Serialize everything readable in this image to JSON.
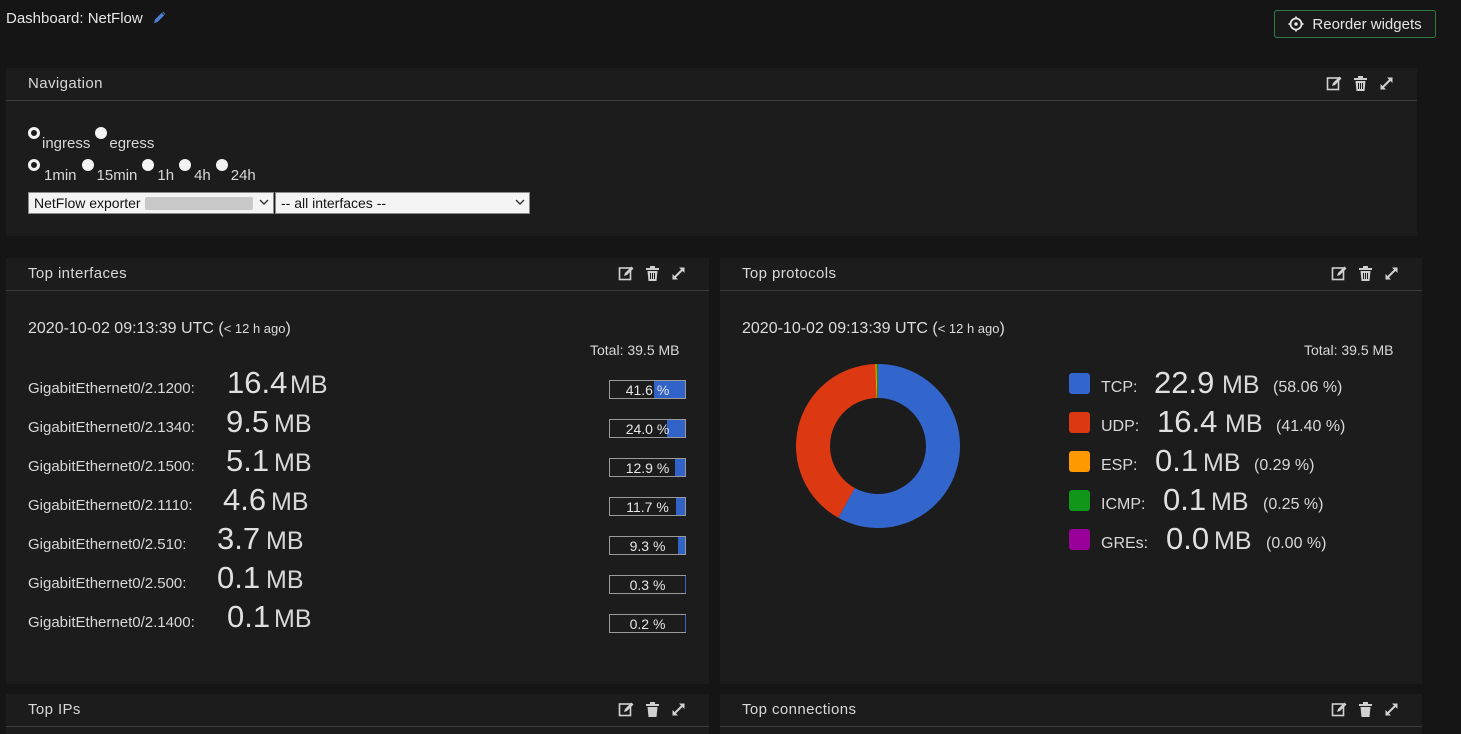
{
  "dashboard": {
    "title": "Dashboard: NetFlow",
    "reorder_label": "Reorder widgets"
  },
  "navigation": {
    "title": "Navigation",
    "direction_options": [
      {
        "label": "ingress",
        "checked": true
      },
      {
        "label": "egress",
        "checked": false
      }
    ],
    "time_options": [
      {
        "label": "1min",
        "checked": true
      },
      {
        "label": "15min",
        "checked": false
      },
      {
        "label": "1h",
        "checked": false
      },
      {
        "label": "4h",
        "checked": false
      },
      {
        "label": "24h",
        "checked": false
      }
    ],
    "exporter_select": "NetFlow exporter",
    "interface_select": "-- all interfaces --"
  },
  "top_interfaces": {
    "title": "Top interfaces",
    "timestamp": "2020-10-02 09:13:39 UTC",
    "timestamp_open": " (",
    "timestamp_ago": "< 12 h ago",
    "timestamp_close": ")",
    "total": "Total: 39.5 MB",
    "rows": [
      {
        "name": "GigabitEthernet0/2.1200:",
        "value": "16.4",
        "unit": "MB",
        "percent": "41.6 %",
        "fraction": 0.416
      },
      {
        "name": "GigabitEthernet0/2.1340:",
        "value": "9.5",
        "unit": "MB",
        "percent": "24.0 %",
        "fraction": 0.24
      },
      {
        "name": "GigabitEthernet0/2.1500:",
        "value": "5.1",
        "unit": "MB",
        "percent": "12.9 %",
        "fraction": 0.129
      },
      {
        "name": "GigabitEthernet0/2.1110:",
        "value": "4.6",
        "unit": "MB",
        "percent": "11.7 %",
        "fraction": 0.117
      },
      {
        "name": "GigabitEthernet0/2.510:",
        "value": "3.7",
        "unit": "MB",
        "percent": "9.3 %",
        "fraction": 0.093
      },
      {
        "name": "GigabitEthernet0/2.500:",
        "value": "0.1",
        "unit": "MB",
        "percent": "0.3 %",
        "fraction": 0.003
      },
      {
        "name": "GigabitEthernet0/2.1400:",
        "value": "0.1",
        "unit": "MB",
        "percent": "0.2 %",
        "fraction": 0.002
      }
    ]
  },
  "top_protocols": {
    "title": "Top protocols",
    "timestamp": "2020-10-02 09:13:39 UTC",
    "timestamp_open": " (",
    "timestamp_ago": "< 12 h ago",
    "timestamp_close": ")",
    "total": "Total: 39.5 MB",
    "legend": [
      {
        "name": "TCP:",
        "value": "22.9",
        "unit": "MB",
        "percent": "(58.06 %)",
        "color": "#3366cc"
      },
      {
        "name": "UDP:",
        "value": "16.4",
        "unit": "MB",
        "percent": "(41.40 %)",
        "color": "#dc3912"
      },
      {
        "name": "ESP:",
        "value": "0.1",
        "unit": "MB",
        "percent": "(0.29 %)",
        "color": "#ff9900"
      },
      {
        "name": "ICMP:",
        "value": "0.1",
        "unit": "MB",
        "percent": "(0.25 %)",
        "color": "#109618"
      },
      {
        "name": "GREs:",
        "value": "0.0",
        "unit": "MB",
        "percent": "(0.00 %)",
        "color": "#990099"
      }
    ]
  },
  "chart_data": {
    "type": "pie",
    "donut": true,
    "categories": [
      "TCP",
      "UDP",
      "ESP",
      "ICMP",
      "GREs"
    ],
    "values": [
      58.06,
      41.4,
      0.29,
      0.25,
      0.0
    ],
    "colors": [
      "#3366cc",
      "#dc3912",
      "#ff9900",
      "#109618",
      "#990099"
    ]
  },
  "bottom_widgets": {
    "top_ips_title": "Top IPs",
    "top_connections_title": "Top connections"
  }
}
